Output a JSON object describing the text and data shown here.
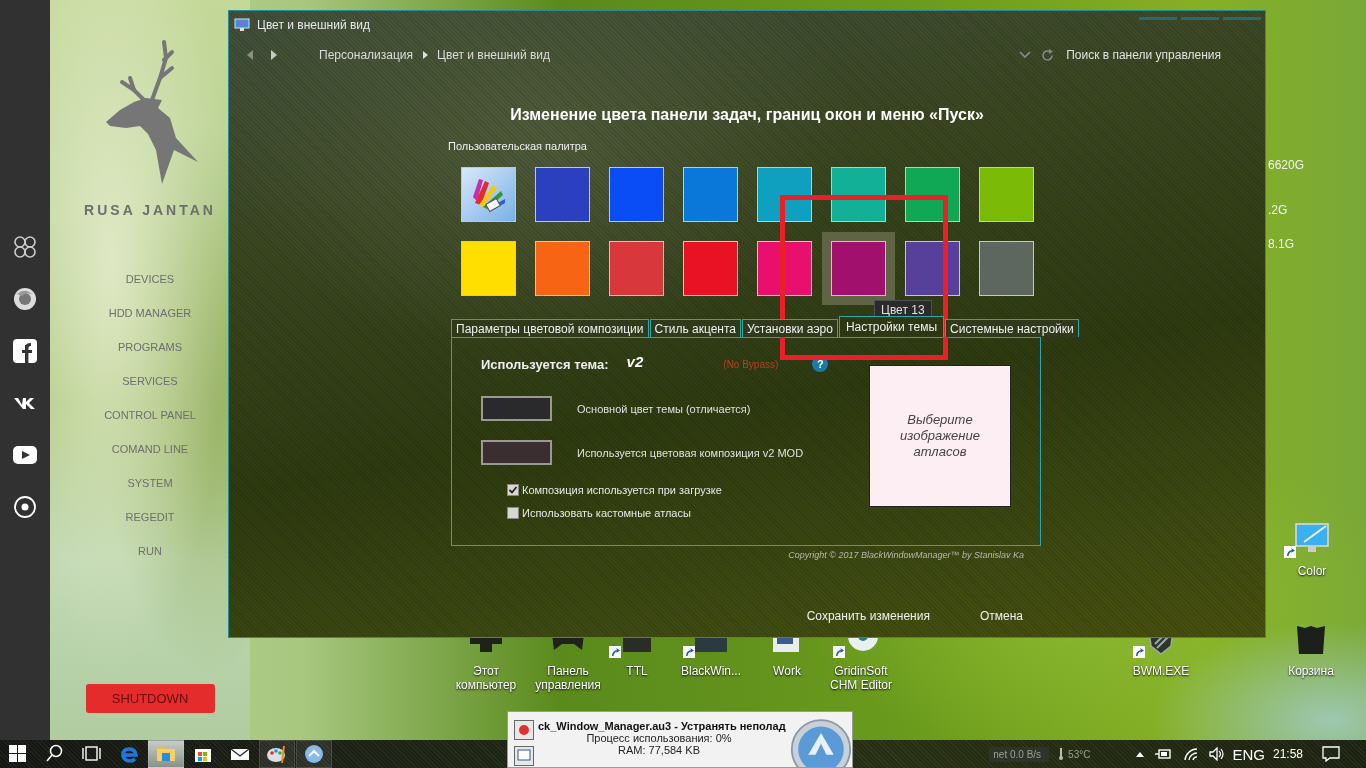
{
  "launcher": {
    "brand": "RUSA JANTAN",
    "menu": [
      "DEVICES",
      "HDD MANAGER",
      "PROGRAMS",
      "SERVICES",
      "CONTROL PANEL",
      "COMAND LINE",
      "SYSTEM",
      "REGEDIT",
      "RUN"
    ],
    "shutdown": "SHUTDOWN"
  },
  "window": {
    "title": "Цвет и внешний вид",
    "breadcrumb": [
      "Персонализация",
      "Цвет и внешний вид"
    ],
    "search_placeholder": "Поиск в панели управления",
    "heading": "Изменение цвета панели задач, границ окон и меню «Пуск»",
    "palette_label": "Пользовательская палитра",
    "swatches": [
      {
        "kind": "custom",
        "selected": false
      },
      {
        "kind": "color",
        "color": "#2a40bf",
        "selected": false
      },
      {
        "kind": "color",
        "color": "#0a4cf5",
        "selected": false
      },
      {
        "kind": "color",
        "color": "#0a78d8",
        "selected": false
      },
      {
        "kind": "color",
        "color": "#0fa0c0",
        "selected": false
      },
      {
        "kind": "color",
        "color": "#12b096",
        "selected": false
      },
      {
        "kind": "color",
        "color": "#10a854",
        "selected": false
      },
      {
        "kind": "color",
        "color": "#7bbb08",
        "selected": false
      },
      {
        "kind": "color",
        "color": "#ffde00",
        "selected": false
      },
      {
        "kind": "color",
        "color": "#f76414",
        "selected": false
      },
      {
        "kind": "color",
        "color": "#d8383c",
        "selected": false
      },
      {
        "kind": "color",
        "color": "#e81224",
        "selected": false
      },
      {
        "kind": "color",
        "color": "#e8106c",
        "selected": false
      },
      {
        "kind": "color",
        "color": "#a2106e",
        "selected": true
      },
      {
        "kind": "color",
        "color": "#56409a",
        "selected": false
      },
      {
        "kind": "color",
        "color": "#5e6660",
        "selected": false
      }
    ],
    "tooltip": "Цвет 13",
    "tabs": [
      {
        "label": "Параметры цветовой композиции",
        "selected": false
      },
      {
        "label": "Стиль акцента",
        "selected": false
      },
      {
        "label": "Установки аэро",
        "selected": false
      },
      {
        "label": "Настройки темы",
        "selected": true
      },
      {
        "label": "Системные настройки",
        "selected": false
      }
    ],
    "theme_label": "Используется тема:",
    "theme_value": "v2",
    "bypass_note": "(No Bypass)",
    "help": "?",
    "color_rows": [
      {
        "color": "#2a2a2c",
        "label": "Основной цвет темы (отличается)"
      },
      {
        "color": "#3a2e30",
        "label": "Используется цветовая композиция v2 MOD"
      }
    ],
    "checkboxes": [
      {
        "label": "Композиция используется при загрузке",
        "checked": true
      },
      {
        "label": "Использовать кастомные атласы",
        "checked": false
      }
    ],
    "atlas_prompt": "Выберите изображение атласов",
    "copyright": "Copyright © 2017 BlackWindowManager™ by Stanislav Ka",
    "buttons": [
      "Сохранить изменения",
      "Отмена"
    ]
  },
  "desktop_stats": [
    "6620G",
    ".2G",
    "8.1G"
  ],
  "desktop_icons": [
    {
      "kind": "computer",
      "label": "Этот компьютер",
      "shortcut": false
    },
    {
      "kind": "gamepad",
      "label": "Панель управления",
      "shortcut": false
    },
    {
      "kind": "sys",
      "label": "TTL",
      "shortcut": true
    },
    {
      "kind": "app",
      "label": "BlackWin...",
      "shortcut": true
    },
    {
      "kind": "folder",
      "label": "Work",
      "shortcut": false
    },
    {
      "kind": "disc",
      "label": "GridinSoft CHM Editor",
      "shortcut": true
    },
    {
      "kind": "shield",
      "label": "BWM.EXE",
      "shortcut": true
    },
    {
      "kind": "monitor",
      "label": "Color",
      "shortcut": true
    },
    {
      "kind": "bin",
      "label": "Корзина",
      "shortcut": false
    }
  ],
  "notification": {
    "title": "ck_Window_Manager.au3 - Устранять неполад",
    "lines": [
      "Процесс использования: 0%",
      "RAM: 77,584 KB"
    ]
  },
  "taskbar": {
    "apps": [
      {
        "kind": "start",
        "selected": false,
        "running": false
      },
      {
        "kind": "search",
        "selected": false,
        "running": false
      },
      {
        "kind": "taskview",
        "selected": false,
        "running": false
      },
      {
        "kind": "edge",
        "selected": false,
        "running": false
      },
      {
        "kind": "explorer",
        "selected": true,
        "running": true
      },
      {
        "kind": "store",
        "selected": false,
        "running": false
      },
      {
        "kind": "mail",
        "selected": false,
        "running": false
      },
      {
        "kind": "paint",
        "selected": false,
        "running": true
      },
      {
        "kind": "autoit",
        "selected": false,
        "running": true
      }
    ],
    "net": "net 0.0 B/s",
    "temp": "53°C",
    "language": "ENG",
    "time": "21:58"
  }
}
